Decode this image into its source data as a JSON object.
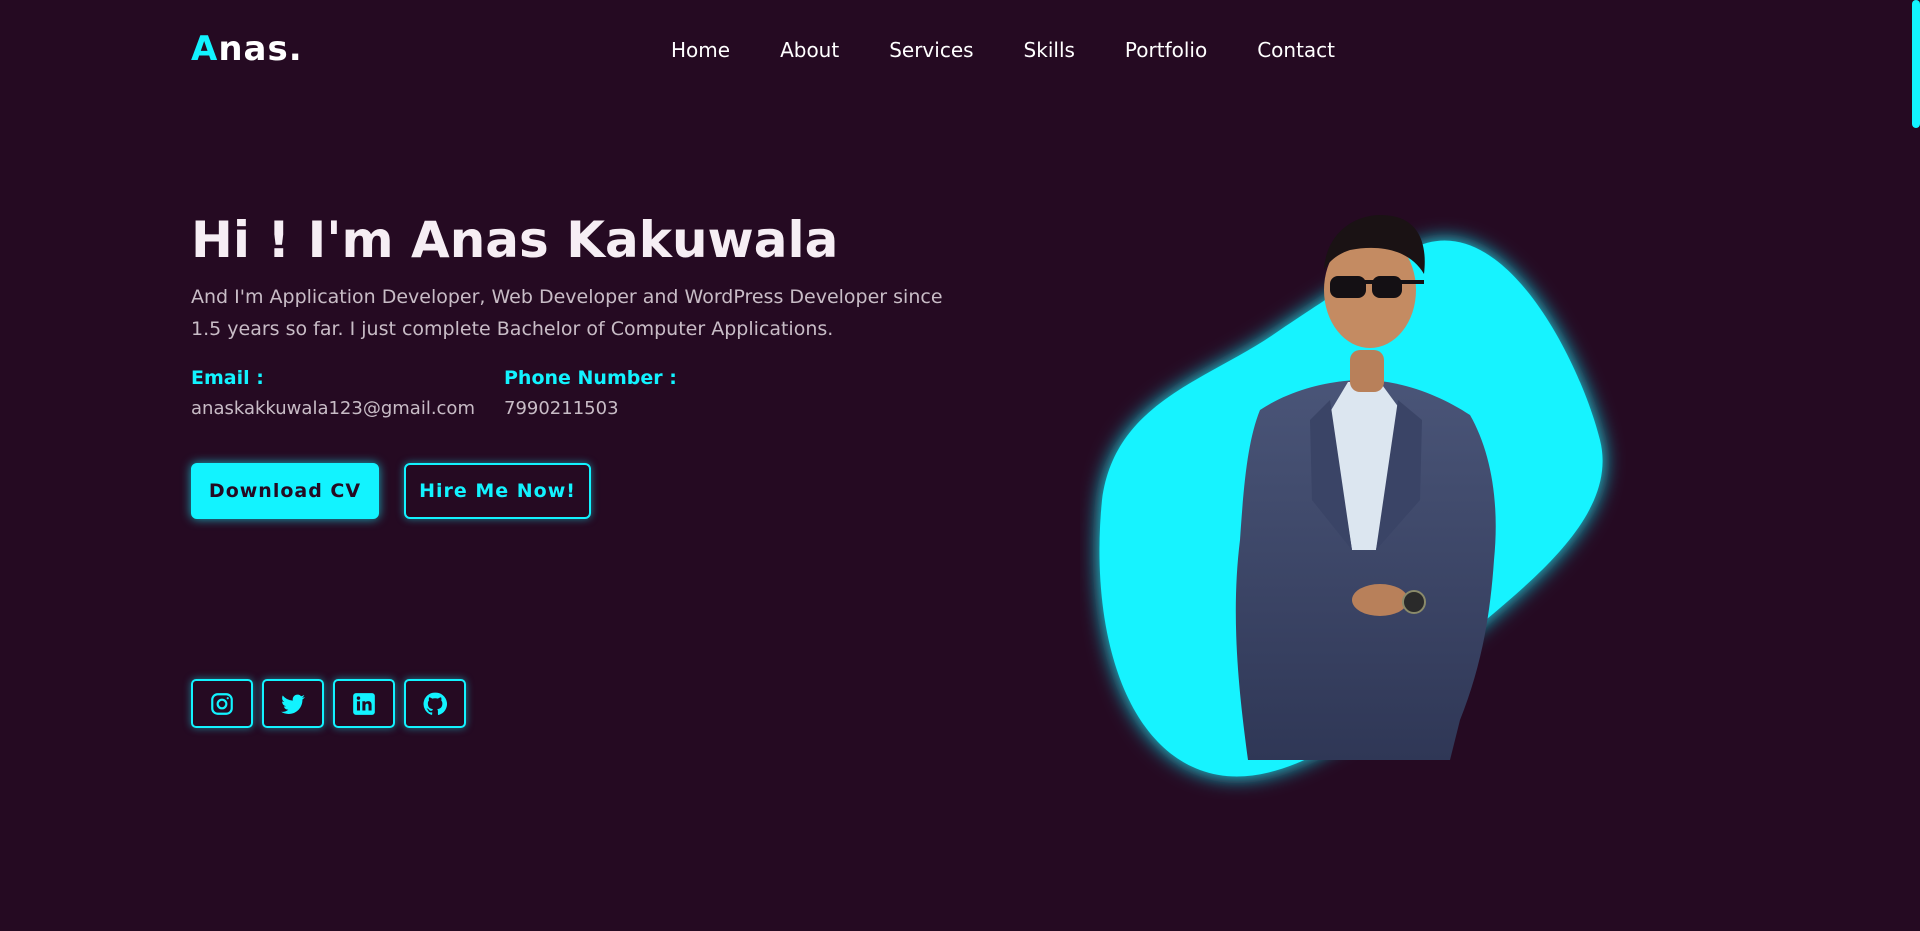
{
  "brand": {
    "logo_initial": "A",
    "logo_rest": "nas.",
    "accent_color": "#12f3ff",
    "background_color": "#250a22"
  },
  "nav": {
    "items": [
      {
        "label": "Home"
      },
      {
        "label": "About"
      },
      {
        "label": "Services"
      },
      {
        "label": "Skills"
      },
      {
        "label": "Portfolio"
      },
      {
        "label": "Contact"
      }
    ]
  },
  "hero": {
    "title": "Hi ! I'm Anas Kakuwala",
    "description": "And I'm Application Developer, Web Developer and WordPress Developer since 1.5 years so far. I just complete Bachelor of Computer Applications.",
    "email_label": "Email :",
    "email_value": "anaskakkuwala123@gmail.com",
    "phone_label": "Phone Number :",
    "phone_value": "7990211503",
    "download_cv_label": "Download CV",
    "hire_me_label": "Hire Me Now!"
  },
  "socials": [
    {
      "icon": "instagram-icon"
    },
    {
      "icon": "twitter-icon"
    },
    {
      "icon": "linkedin-icon"
    },
    {
      "icon": "github-icon"
    }
  ]
}
